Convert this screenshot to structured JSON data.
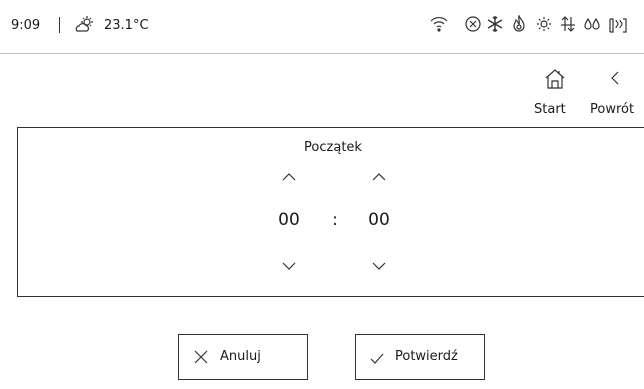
{
  "status": {
    "time": "9:09",
    "temperature": "23.1°C",
    "icons": [
      "wifi-icon",
      "close-circle-icon",
      "snowflake-icon",
      "flame-icon",
      "gear-icon",
      "flow-arrows-icon",
      "drops-icon",
      "heating-icon"
    ]
  },
  "nav": {
    "home_label": "Start",
    "back_label": "Powrót"
  },
  "panel": {
    "title": "Początek",
    "hours": "00",
    "separator": ":",
    "minutes": "00"
  },
  "actions": {
    "cancel_label": "Anuluj",
    "confirm_label": "Potwierdź"
  }
}
